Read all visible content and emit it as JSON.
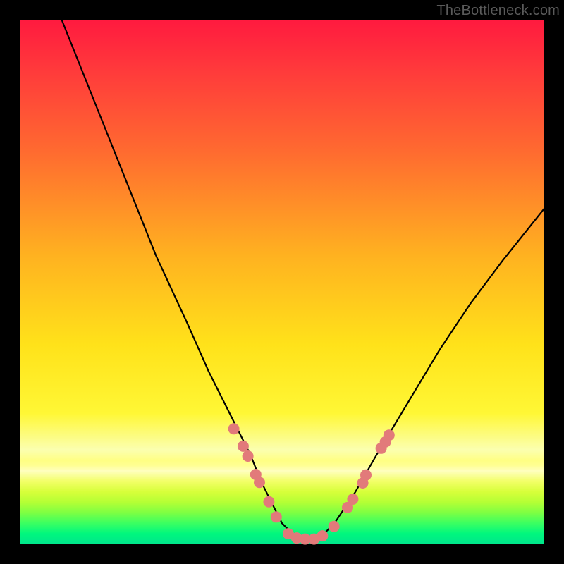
{
  "watermark": "TheBottleneck.com",
  "chart_data": {
    "type": "line",
    "title": "",
    "xlabel": "",
    "ylabel": "",
    "xlim": [
      0,
      100
    ],
    "ylim": [
      0,
      100
    ],
    "grid": false,
    "legend": false,
    "series": [
      {
        "name": "curve",
        "x": [
          8,
          14,
          20,
          26,
          32,
          36,
          40,
          44,
          46,
          48,
          50,
          52,
          54,
          56,
          58,
          60,
          64,
          68,
          74,
          80,
          86,
          92,
          100
        ],
        "y": [
          100,
          85,
          70,
          55,
          42,
          33,
          25,
          17,
          12,
          8,
          4,
          2,
          1,
          1,
          2,
          4,
          10,
          17,
          27,
          37,
          46,
          54,
          64
        ]
      }
    ],
    "markers": [
      {
        "x": 40.8,
        "y": 22.0
      },
      {
        "x": 42.6,
        "y": 18.7
      },
      {
        "x": 43.5,
        "y": 16.8
      },
      {
        "x": 45.0,
        "y": 13.3
      },
      {
        "x": 45.7,
        "y": 11.8
      },
      {
        "x": 47.5,
        "y": 8.1
      },
      {
        "x": 48.9,
        "y": 5.2
      },
      {
        "x": 51.2,
        "y": 2.0
      },
      {
        "x": 52.8,
        "y": 1.2
      },
      {
        "x": 54.4,
        "y": 1.0
      },
      {
        "x": 56.1,
        "y": 1.0
      },
      {
        "x": 57.7,
        "y": 1.6
      },
      {
        "x": 59.9,
        "y": 3.4
      },
      {
        "x": 62.5,
        "y": 7.0
      },
      {
        "x": 63.5,
        "y": 8.6
      },
      {
        "x": 65.4,
        "y": 11.7
      },
      {
        "x": 66.0,
        "y": 13.2
      },
      {
        "x": 68.9,
        "y": 18.3
      },
      {
        "x": 69.7,
        "y": 19.5
      },
      {
        "x": 70.4,
        "y": 20.8
      }
    ]
  }
}
